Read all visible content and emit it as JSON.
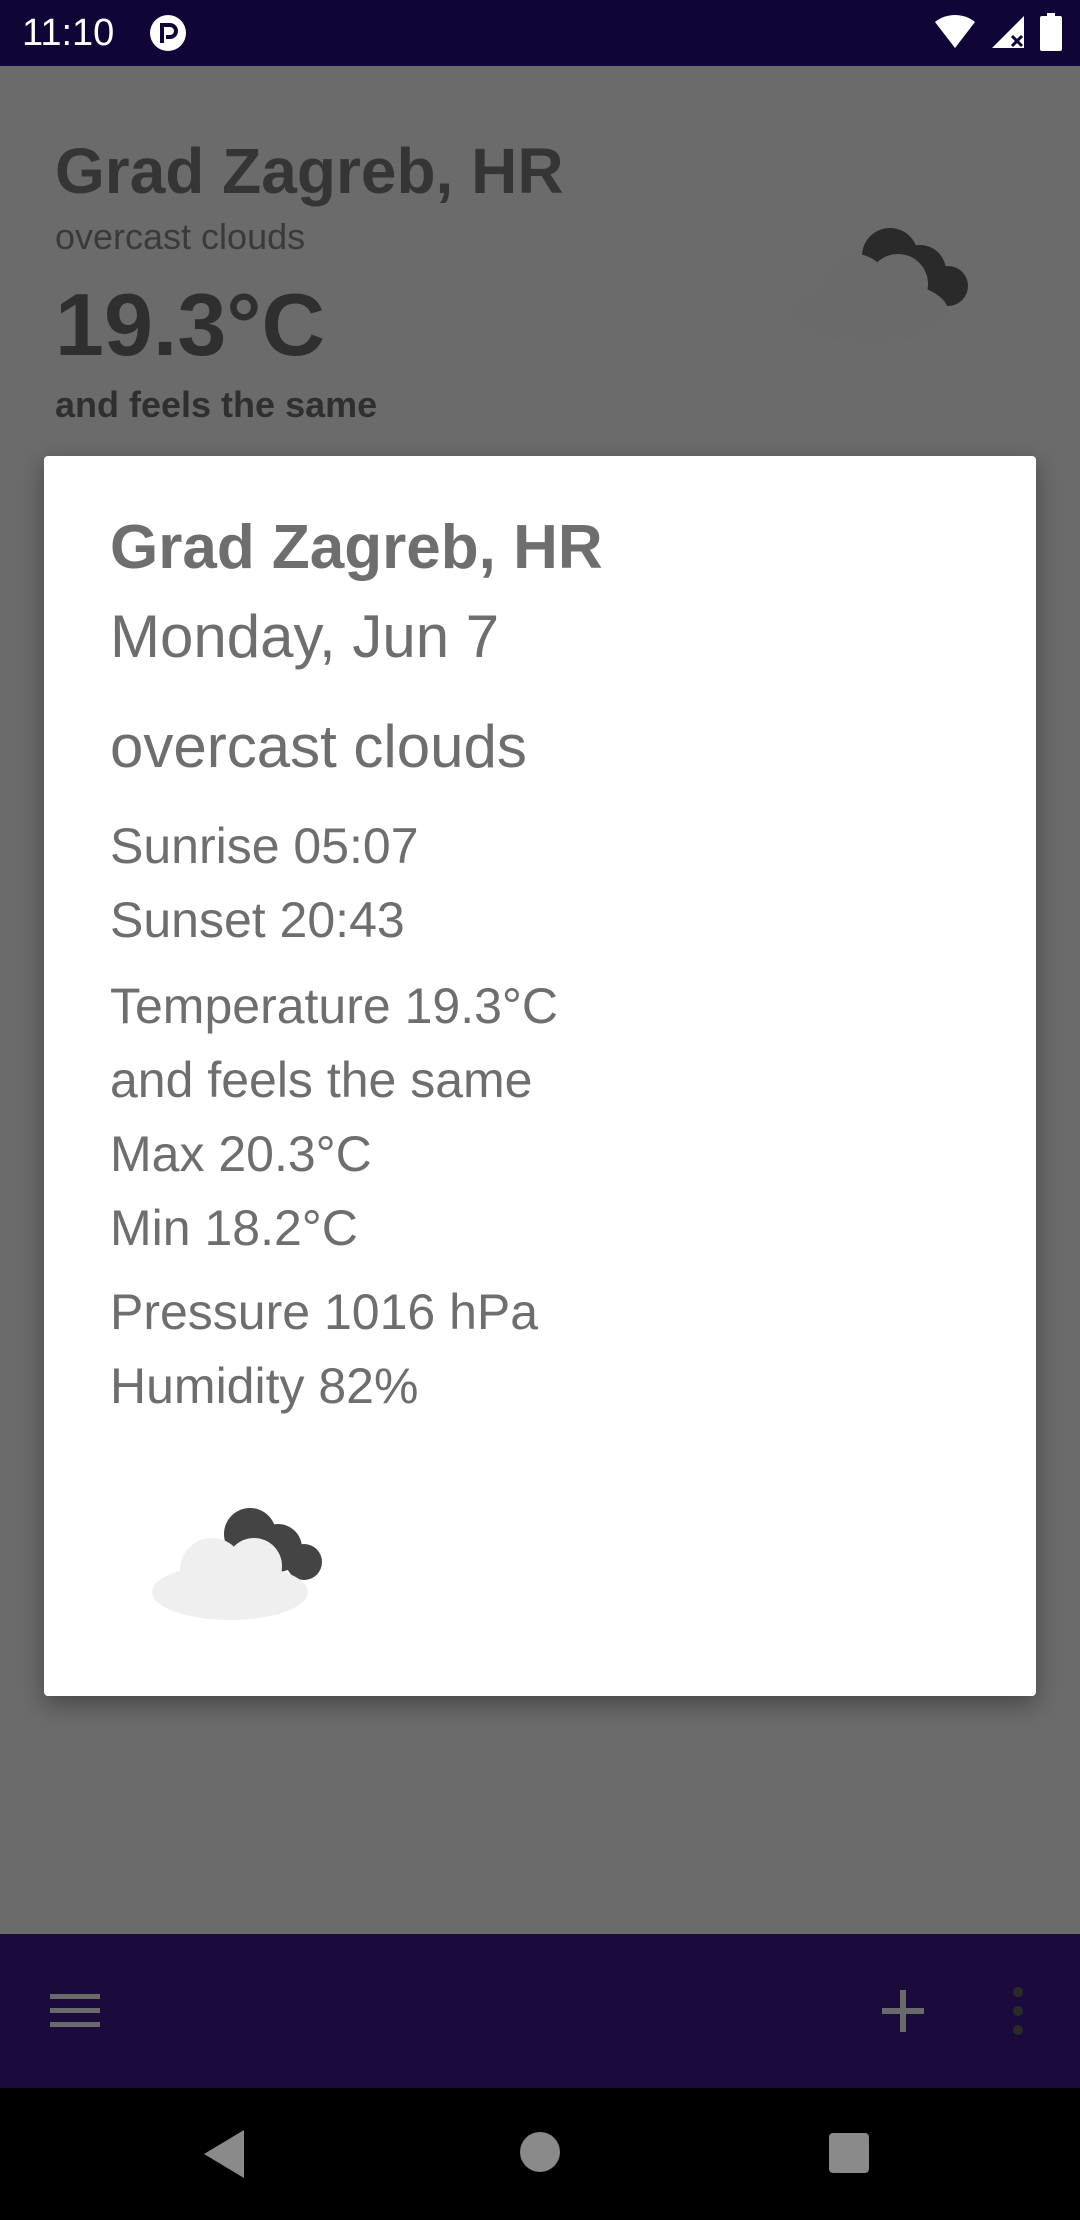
{
  "status_bar": {
    "time": "11:10",
    "icons": [
      "app-notification-icon",
      "wifi-icon",
      "cell-signal-icon",
      "battery-icon"
    ]
  },
  "main": {
    "city": "Grad Zagreb, HR",
    "description": "overcast clouds",
    "temperature": "19.3°C",
    "feels_like": "and feels the same",
    "weather_icon": "overcast-clouds-icon"
  },
  "dialog": {
    "city": "Grad Zagreb, HR",
    "date": "Monday, Jun 7",
    "description": "overcast clouds",
    "sunrise": "Sunrise 05:07",
    "sunset": "Sunset 20:43",
    "temperature": "Temperature 19.3°C",
    "feels_like": "and feels the same",
    "max": "Max 20.3°C",
    "min": "Min 18.2°C",
    "pressure": "Pressure 1016 hPa",
    "humidity": "Humidity 82%",
    "weather_icon": "overcast-clouds-icon"
  },
  "bottom_bar": {
    "icons": [
      "menu-icon",
      "add-icon",
      "more-vert-icon"
    ]
  },
  "nav_bar": {
    "icons": [
      "back-icon",
      "home-icon",
      "recents-icon"
    ]
  },
  "colors": {
    "status_bar": "#110537",
    "bottom_bar": "#1b0b3c",
    "scrim_background": "#6b6b6b",
    "dialog_background": "#ffffff",
    "dialog_text": "#6e6e6e"
  }
}
